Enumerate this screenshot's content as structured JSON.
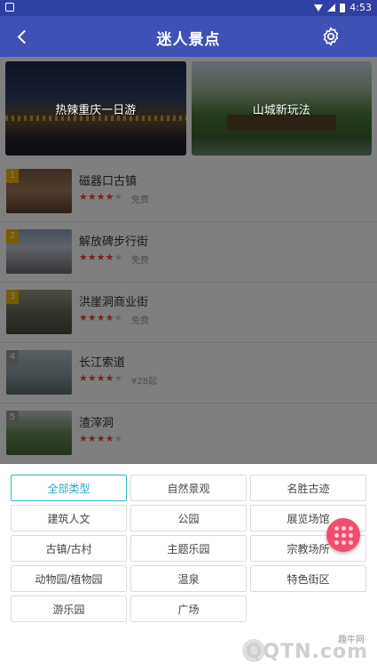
{
  "status": {
    "time": "4:53"
  },
  "appbar": {
    "title": "迷人景点"
  },
  "banners": [
    {
      "caption": "热辣重庆一日游"
    },
    {
      "caption": "山城新玩法"
    }
  ],
  "spots": [
    {
      "rank": "1",
      "name": "磁器口古镇",
      "stars": "★★★★",
      "half": "★",
      "price": "免费"
    },
    {
      "rank": "2",
      "name": "解放碑步行街",
      "stars": "★★★★",
      "half": "★",
      "price": "免费"
    },
    {
      "rank": "3",
      "name": "洪崖洞商业街",
      "stars": "★★★★",
      "half": "★",
      "price": "免费"
    },
    {
      "rank": "4",
      "name": "长江索道",
      "stars": "★★★★",
      "half": "★",
      "price": "¥28起"
    },
    {
      "rank": "5",
      "name": "渣滓洞",
      "stars": "★★★★",
      "half": "★",
      "price": ""
    }
  ],
  "filters": {
    "options": [
      "全部类型",
      "自然景观",
      "名胜古迹",
      "建筑人文",
      "公园",
      "展览场馆",
      "古镇/古村",
      "主题乐园",
      "宗教场所",
      "动物园/植物园",
      "温泉",
      "特色街区",
      "游乐园",
      "广场"
    ]
  },
  "watermark": {
    "small": "趣牛网",
    "big": "QQTN.com"
  }
}
